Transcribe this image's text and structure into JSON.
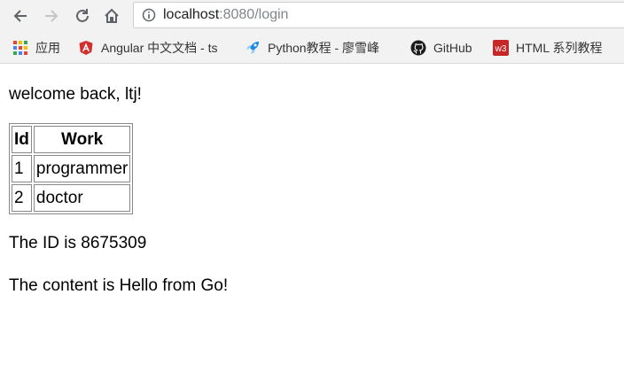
{
  "browser": {
    "url_host": "localhost",
    "url_rest": ":8080/login"
  },
  "bookmarks": [
    {
      "label": "应用",
      "icon": "apps-grid-icon"
    },
    {
      "label": "Angular 中文文档 - ts",
      "icon": "angular-icon"
    },
    {
      "label": "Python教程 - 廖雪峰",
      "icon": "rocket-icon"
    },
    {
      "label": "GitHub",
      "icon": "github-icon"
    },
    {
      "label": "HTML 系列教程",
      "icon": "w3-icon"
    }
  ],
  "page": {
    "welcome": "welcome back, ltj!",
    "table": {
      "headers": [
        "Id",
        "Work"
      ],
      "rows": [
        [
          "1",
          "programmer"
        ],
        [
          "2",
          "doctor"
        ]
      ]
    },
    "id_line": "The ID is 8675309",
    "content_line": "The content is Hello from Go!"
  },
  "colors": {
    "toolbar_bg": "#f2f2f2",
    "angular_red": "#d32f2f",
    "w3_red": "#c62828",
    "rocket_blue": "#1e88e5"
  }
}
